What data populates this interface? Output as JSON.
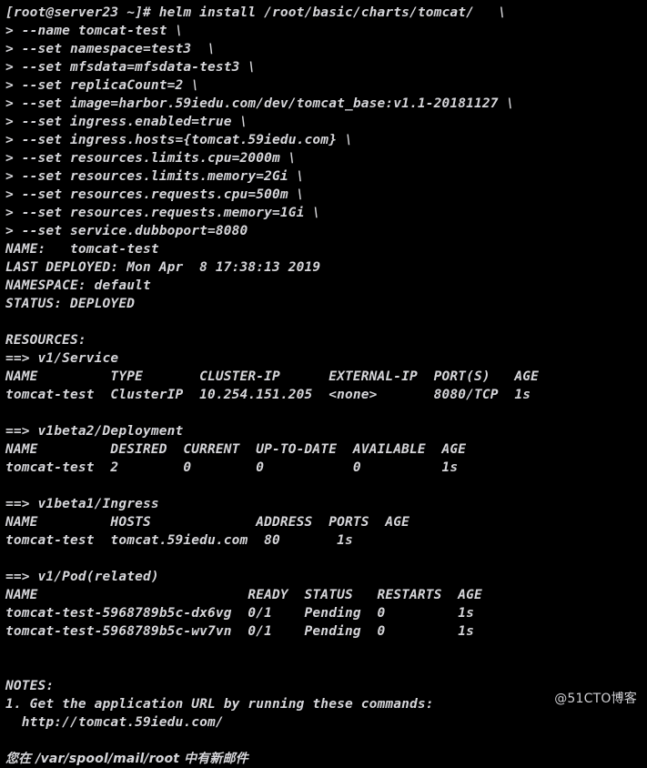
{
  "terminal": {
    "colors": {
      "background": "#000000",
      "foreground": "#d6d6da",
      "watermark": "#cfcfd3"
    },
    "prompt": "[root@server23 ~]#",
    "command": "helm install /root/basic/charts/tomcat/",
    "continuation_marker": ">",
    "lines": [
      "[root@server23 ~]# helm install /root/basic/charts/tomcat/   \\",
      "> --name tomcat-test \\",
      "> --set namespace=test3  \\",
      "> --set mfsdata=mfsdata-test3 \\",
      "> --set replicaCount=2 \\",
      "> --set image=harbor.59iedu.com/dev/tomcat_base:v1.1-20181127 \\",
      "> --set ingress.enabled=true \\",
      "> --set ingress.hosts={tomcat.59iedu.com} \\",
      "> --set resources.limits.cpu=2000m \\",
      "> --set resources.limits.memory=2Gi \\",
      "> --set resources.requests.cpu=500m \\",
      "> --set resources.requests.memory=1Gi \\",
      "> --set service.dubboport=8080",
      "NAME:   tomcat-test",
      "LAST DEPLOYED: Mon Apr  8 17:38:13 2019",
      "NAMESPACE: default",
      "STATUS: DEPLOYED",
      "",
      "RESOURCES:",
      "==> v1/Service",
      "NAME         TYPE       CLUSTER-IP      EXTERNAL-IP  PORT(S)   AGE",
      "tomcat-test  ClusterIP  10.254.151.205  <none>       8080/TCP  1s",
      "",
      "==> v1beta2/Deployment",
      "NAME         DESIRED  CURRENT  UP-TO-DATE  AVAILABLE  AGE",
      "tomcat-test  2        0        0           0          1s",
      "",
      "==> v1beta1/Ingress",
      "NAME         HOSTS             ADDRESS  PORTS  AGE",
      "tomcat-test  tomcat.59iedu.com  80       1s",
      "",
      "==> v1/Pod(related)",
      "NAME                          READY  STATUS   RESTARTS  AGE",
      "tomcat-test-5968789b5c-dx6vg  0/1    Pending  0         1s",
      "tomcat-test-5968789b5c-wv7vn  0/1    Pending  0         1s",
      "",
      "",
      "NOTES:",
      "1. Get the application URL by running these commands:",
      "  http://tomcat.59iedu.com/",
      "",
      "您在 /var/spool/mail/root 中有新邮件"
    ],
    "release": {
      "name_label": "NAME:",
      "name_value": "tomcat-test",
      "last_deployed_label": "LAST DEPLOYED:",
      "last_deployed_value": "Mon Apr  8 17:38:13 2019",
      "namespace_label": "NAMESPACE:",
      "namespace_value": "default",
      "status_label": "STATUS:",
      "status_value": "DEPLOYED"
    },
    "resources_heading": "RESOURCES:",
    "resource_sections": [
      {
        "heading": "==> v1/Service",
        "columns": [
          "NAME",
          "TYPE",
          "CLUSTER-IP",
          "EXTERNAL-IP",
          "PORT(S)",
          "AGE"
        ],
        "rows": [
          [
            "tomcat-test",
            "ClusterIP",
            "10.254.151.205",
            "<none>",
            "8080/TCP",
            "1s"
          ]
        ]
      },
      {
        "heading": "==> v1beta2/Deployment",
        "columns": [
          "NAME",
          "DESIRED",
          "CURRENT",
          "UP-TO-DATE",
          "AVAILABLE",
          "AGE"
        ],
        "rows": [
          [
            "tomcat-test",
            "2",
            "0",
            "0",
            "0",
            "1s"
          ]
        ]
      },
      {
        "heading": "==> v1beta1/Ingress",
        "columns": [
          "NAME",
          "HOSTS",
          "ADDRESS",
          "PORTS",
          "AGE"
        ],
        "rows": [
          [
            "tomcat-test",
            "tomcat.59iedu.com",
            "80",
            "1s",
            ""
          ]
        ]
      },
      {
        "heading": "==> v1/Pod(related)",
        "columns": [
          "NAME",
          "READY",
          "STATUS",
          "RESTARTS",
          "AGE"
        ],
        "rows": [
          [
            "tomcat-test-5968789b5c-dx6vg",
            "0/1",
            "Pending",
            "0",
            "1s"
          ],
          [
            "tomcat-test-5968789b5c-wv7vn",
            "0/1",
            "Pending",
            "0",
            "1s"
          ]
        ]
      }
    ],
    "notes": {
      "heading": "NOTES:",
      "item_1": "1. Get the application URL by running these commands:",
      "url": "http://tomcat.59iedu.com/"
    },
    "mail_notice": "您在 /var/spool/mail/root 中有新邮件"
  },
  "watermark": {
    "text": "@51CTO博客"
  }
}
